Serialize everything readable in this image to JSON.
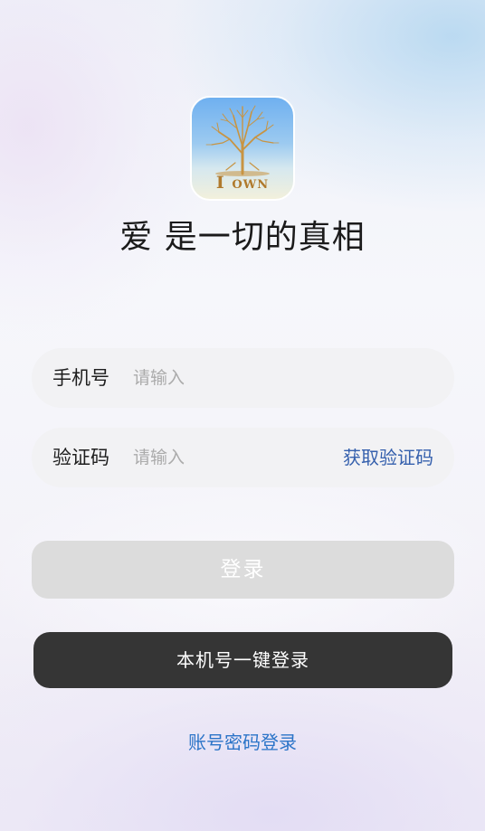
{
  "logo": {
    "icon": "tree-icon",
    "text_big": "I",
    "text_small": "OWN"
  },
  "slogan": "爱 是一切的真相",
  "form": {
    "phone": {
      "label": "手机号",
      "placeholder": "请输入",
      "value": ""
    },
    "code": {
      "label": "验证码",
      "placeholder": "请输入",
      "value": "",
      "get_code_label": "获取验证码"
    }
  },
  "buttons": {
    "login": "登录",
    "one_key_login": "本机号一键登录",
    "account_login": "账号密码登录"
  },
  "colors": {
    "link_blue": "#3560ad",
    "account_link_blue": "#2b74c8",
    "dark_button": "#353535",
    "disabled_button": "#dcdcdc",
    "logo_gold": "#b07a2c"
  }
}
